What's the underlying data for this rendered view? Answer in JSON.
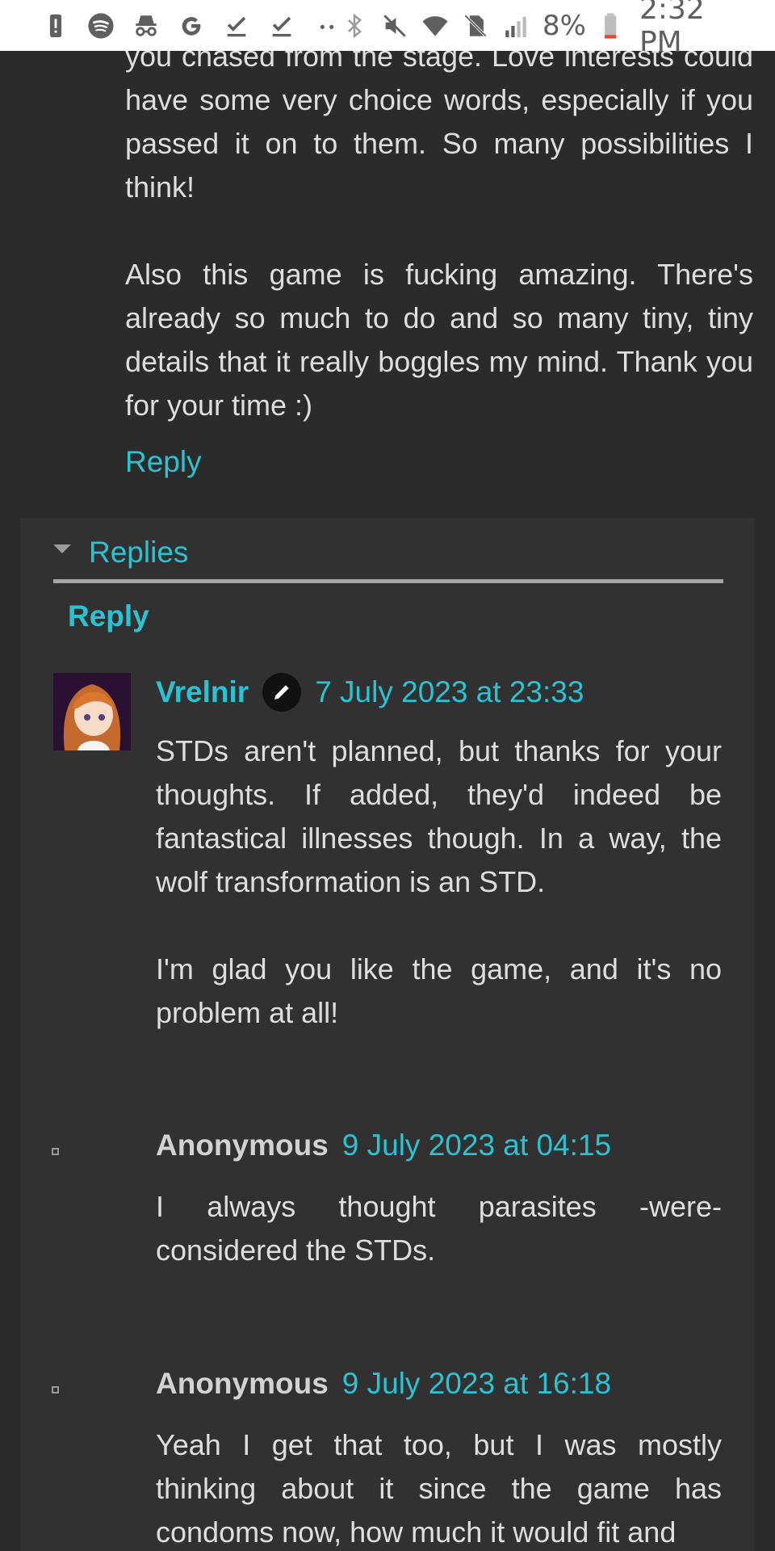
{
  "status_bar": {
    "left_icons": [
      "alert-icon",
      "spotify-icon",
      "incognito-icon",
      "google-icon",
      "download-done-icon",
      "download-done-icon",
      "more-dots-icon"
    ],
    "right_icons": [
      "bluetooth-icon",
      "mute-icon",
      "wifi-icon",
      "no-sim-icon",
      "signal-icon"
    ],
    "battery": "8%",
    "time": "2:32 PM"
  },
  "top_comment": {
    "paragraphs": [
      "you chased from the stage. Love interests could have some very choice words, especially if you passed it on to them. So many possibilities I think!",
      "Also this game is fucking amazing. There's already so much to do and so many tiny, tiny details that it really boggles my mind. Thank you for your time :)"
    ],
    "reply_label": "Reply"
  },
  "replies": {
    "toggle_label": "Replies",
    "reply_label": "Reply",
    "comments": [
      {
        "author": "Vrelnir",
        "date": "7 July 2023 at 23:33",
        "paragraphs": [
          "STDs aren't planned, but thanks for your thoughts. If added, they'd indeed be fantastical illnesses though. In a way, the wolf transformation is an STD.",
          "I'm glad you like the game, and it's no problem at all!"
        ]
      },
      {
        "author": "Anonymous",
        "date": "9 July 2023 at 04:15",
        "paragraphs": [
          "I always thought parasites -were-considered the STDs."
        ]
      },
      {
        "author": "Anonymous",
        "date": "9 July 2023 at 16:18",
        "paragraphs": [
          "Yeah I get that too, but I was mostly thinking about it since the game has condoms now, how much it would fit and"
        ]
      }
    ]
  },
  "colors": {
    "background": "#2b2b2b",
    "panel": "#313131",
    "link": "#2bc3d3",
    "text": "#dedede"
  }
}
